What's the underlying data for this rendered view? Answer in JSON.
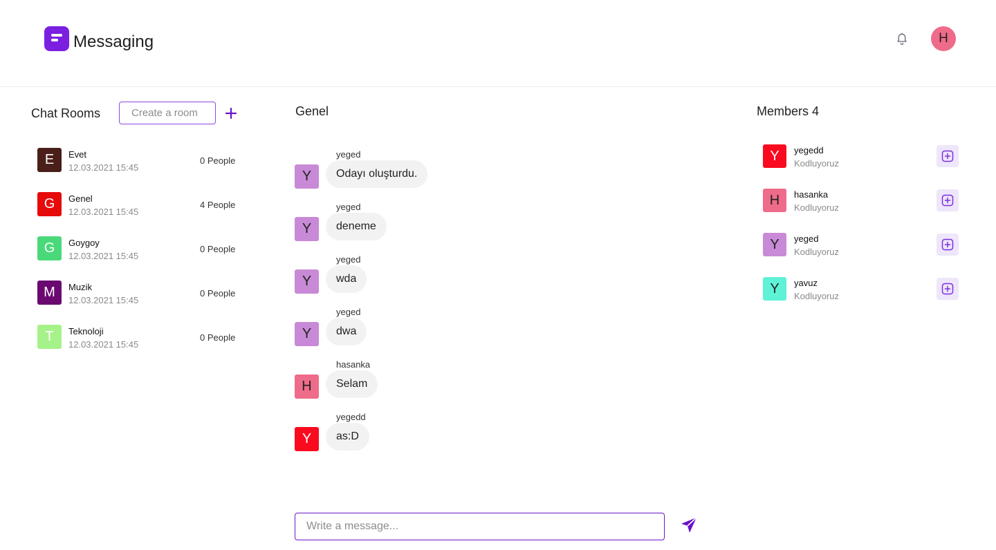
{
  "app": {
    "title": "Messaging",
    "brand_color": "#7b1fe0"
  },
  "header": {
    "user_initial": "H",
    "user_avatar_color": "#ef6b8a",
    "notification_icon": "bell-icon"
  },
  "rooms": {
    "title": "Chat Rooms",
    "create_placeholder": "Create a room",
    "add_icon": "plus-icon",
    "items": [
      {
        "initial": "E",
        "name": "Evet",
        "time": "12.03.2021 15:45",
        "people": "0 People",
        "color": "#4a1f1a"
      },
      {
        "initial": "G",
        "name": "Genel",
        "time": "12.03.2021 15:45",
        "people": "4 People",
        "color": "#e60a0a"
      },
      {
        "initial": "G",
        "name": "Goygoy",
        "time": "12.03.2021 15:45",
        "people": "0 People",
        "color": "#4ad97a"
      },
      {
        "initial": "M",
        "name": "Muzik",
        "time": "12.03.2021 15:45",
        "people": "0 People",
        "color": "#6a0a70"
      },
      {
        "initial": "T",
        "name": "Teknoloji",
        "time": "12.03.2021 15:45",
        "people": "0 People",
        "color": "#a6f28a"
      }
    ]
  },
  "chat": {
    "title": "Genel",
    "input_placeholder": "Write a message...",
    "send_icon": "send-icon",
    "messages": [
      {
        "author": "yeged",
        "initial": "Y",
        "text": "Odayı oluşturdu.",
        "color": "#c88ad6"
      },
      {
        "author": "yeged",
        "initial": "Y",
        "text": "deneme",
        "color": "#c88ad6"
      },
      {
        "author": "yeged",
        "initial": "Y",
        "text": "wda",
        "color": "#c88ad6"
      },
      {
        "author": "yeged",
        "initial": "Y",
        "text": "dwa",
        "color": "#c88ad6"
      },
      {
        "author": "hasanka",
        "initial": "H",
        "text": "Selam",
        "color": "#ef6b8a"
      },
      {
        "author": "yegedd",
        "initial": "Y",
        "text": "as:D",
        "color": "#fa0a1e"
      }
    ]
  },
  "members": {
    "title": "Members 4",
    "add_icon": "plus-square-icon",
    "items": [
      {
        "initial": "Y",
        "name": "yegedd",
        "status": "Kodluyoruz",
        "color": "#fa0a1e",
        "text_color": "#ffffff"
      },
      {
        "initial": "H",
        "name": "hasanka",
        "status": "Kodluyoruz",
        "color": "#ef6b8a",
        "text_color": "#222222"
      },
      {
        "initial": "Y",
        "name": "yeged",
        "status": "Kodluyoruz",
        "color": "#c88ad6",
        "text_color": "#222222"
      },
      {
        "initial": "Y",
        "name": "yavuz",
        "status": "Kodluyoruz",
        "color": "#5ef2d6",
        "text_color": "#222222"
      }
    ]
  }
}
